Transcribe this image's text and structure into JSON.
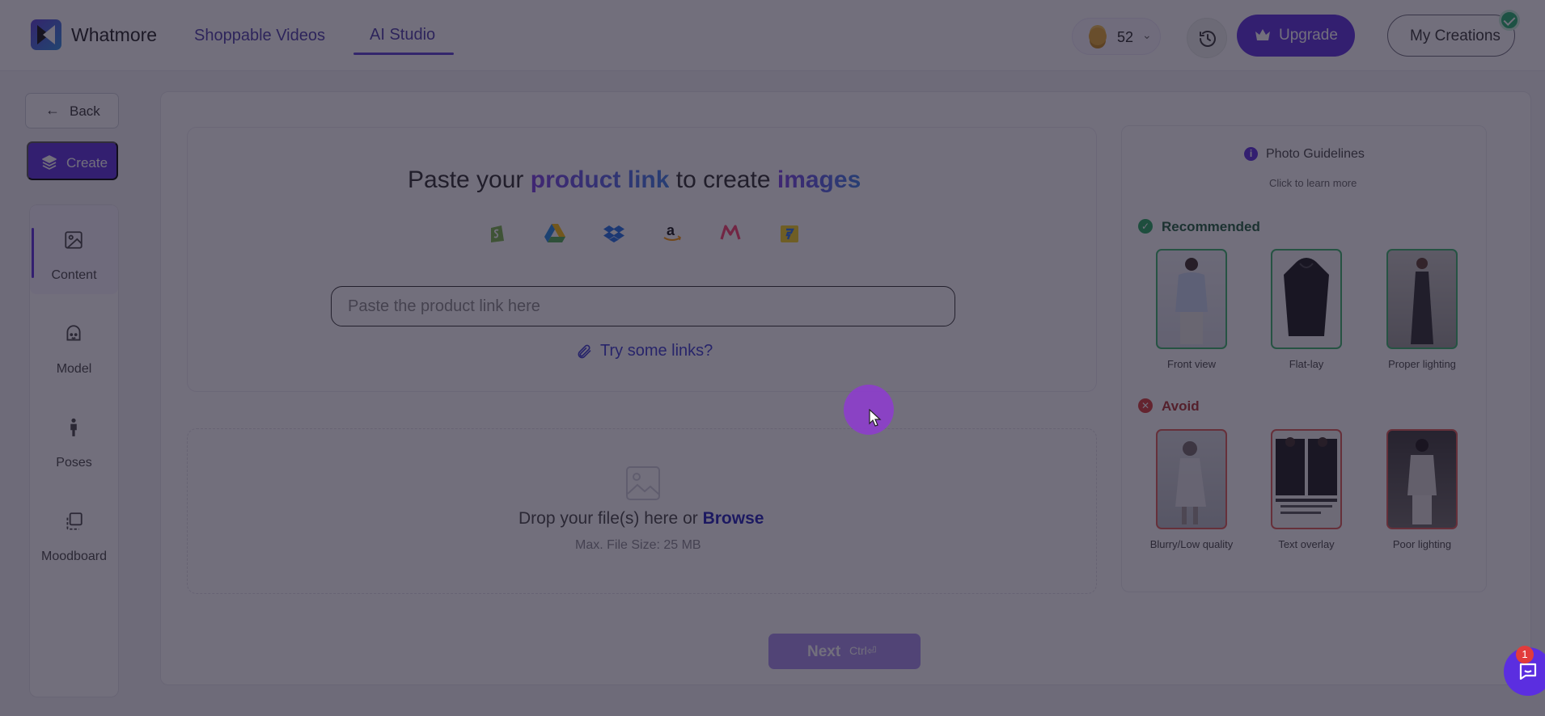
{
  "app": {
    "brand": "Whatmore",
    "nav": {
      "shoppable": "Shoppable Videos",
      "ai_studio": "AI Studio"
    },
    "credits": "52",
    "upgrade": "Upgrade",
    "my_creations": "My Creations"
  },
  "sidebar": {
    "back": "Back",
    "create": "Create",
    "items": [
      {
        "label": "Content",
        "icon": "image-icon"
      },
      {
        "label": "Model",
        "icon": "face-icon"
      },
      {
        "label": "Poses",
        "icon": "person-icon"
      },
      {
        "label": "Moodboard",
        "icon": "layers-icon"
      }
    ]
  },
  "link_section": {
    "headline": {
      "part1": "Paste your",
      "highlight1": "product link",
      "part2": "to create",
      "highlight2": "images"
    },
    "sources": [
      "shopify-icon",
      "google-drive-icon",
      "dropbox-icon",
      "amazon-icon",
      "myntra-icon",
      "flipkart-icon"
    ],
    "input_placeholder": "Paste the product link here",
    "try_links": "Try some links?"
  },
  "upload": {
    "drop_text": "Drop your file(s) here or",
    "browse": "Browse",
    "max_size": "Max. File Size: 25 MB"
  },
  "next": {
    "label": "Next",
    "shortcut": "Ctrl⏎"
  },
  "guidelines": {
    "title": "Photo Guidelines",
    "subtitle": "Click to learn more",
    "recommended": {
      "label": "Recommended",
      "items": [
        "Front view",
        "Flat-lay",
        "Proper lighting"
      ]
    },
    "avoid": {
      "label": "Avoid",
      "items": [
        "Blurry/Low quality",
        "Text overlay",
        "Poor lighting"
      ]
    }
  },
  "chat": {
    "badge": "1"
  },
  "colors": {
    "accent": "#5b2ee0",
    "overlay": "#1c162c",
    "success": "#22a85e",
    "danger": "#d93a35"
  }
}
